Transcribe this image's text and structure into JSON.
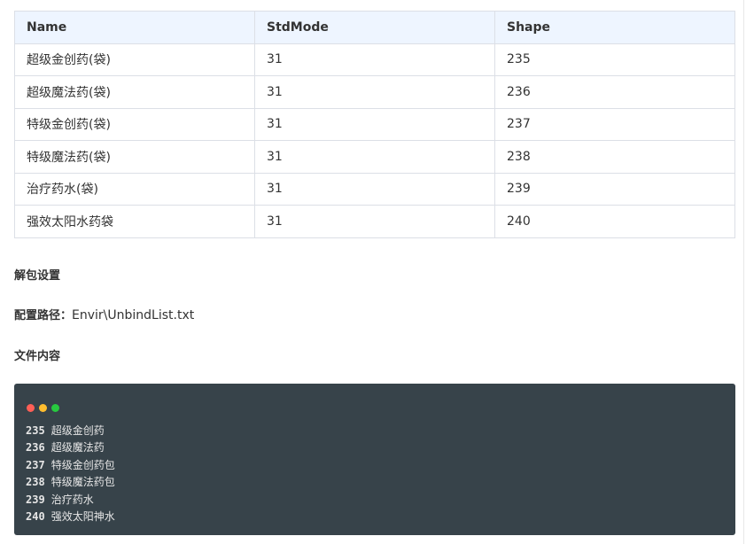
{
  "table": {
    "headers": [
      "Name",
      "StdMode",
      "Shape"
    ],
    "rows": [
      [
        "超级金创药(袋)",
        "31",
        "235"
      ],
      [
        "超级魔法药(袋)",
        "31",
        "236"
      ],
      [
        "特级金创药(袋)",
        "31",
        "237"
      ],
      [
        "特级魔法药(袋)",
        "31",
        "238"
      ],
      [
        "治疗药水(袋)",
        "31",
        "239"
      ],
      [
        "强效太阳水药袋",
        "31",
        "240"
      ]
    ]
  },
  "unbind_section": {
    "title": "解包设置",
    "path_label": "配置路径：",
    "path_value": "Envir\\UnbindList.txt",
    "content_title": "文件内容"
  },
  "code_block": {
    "window_dot_colors": [
      "#ff5f56",
      "#ffbd2e",
      "#27c93f"
    ],
    "lines": [
      {
        "num": "235",
        "text": "超级金创药"
      },
      {
        "num": "236",
        "text": "超级魔法药"
      },
      {
        "num": "237",
        "text": "特级金创药包"
      },
      {
        "num": "238",
        "text": "特级魔法药包"
      },
      {
        "num": "239",
        "text": "治疗药水"
      },
      {
        "num": "240",
        "text": "强效太阳神水"
      }
    ]
  }
}
